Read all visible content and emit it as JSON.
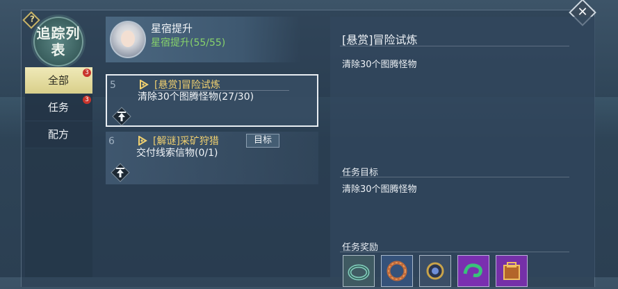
{
  "window": {
    "title": "追踪列表",
    "help_icon": "?",
    "close_icon": "✕"
  },
  "tabs": [
    {
      "label": "全部",
      "badge": "3",
      "active": true
    },
    {
      "label": "任务",
      "badge": "3",
      "active": false
    },
    {
      "label": "配方",
      "badge": "",
      "active": false
    }
  ],
  "star_card": {
    "title": "星宿提升",
    "subtitle": "星宿提升(55/55)"
  },
  "quests": [
    {
      "index": "5",
      "title": "[悬赏]冒险试炼",
      "desc": "清除30个图腾怪物(27/30)",
      "goal_label": "",
      "selected": true
    },
    {
      "index": "6",
      "title": "[解谜]采矿狩猎",
      "desc": "交付线索信物(0/1)",
      "goal_label": "目标",
      "selected": false
    }
  ],
  "detail": {
    "title": "[悬赏]冒险试炼",
    "description": "清除30个图腾怪物",
    "goal_heading": "任务目标",
    "goal_text": "清除30个图腾怪物",
    "reward_heading": "任务奖励",
    "rewards": [
      {
        "icon": "ring-icon",
        "bg": "#3f5a62"
      },
      {
        "icon": "bracelet-icon",
        "bg": "#35527a"
      },
      {
        "icon": "gem-icon",
        "bg": "#3b4e66"
      },
      {
        "icon": "jade-icon",
        "bg": "#7a2fb0"
      },
      {
        "icon": "chest-icon",
        "bg": "#7530a8"
      }
    ]
  },
  "colors": {
    "quest_title": "#f0d070",
    "progress_green": "#87d36b",
    "badge_red": "#c8342c"
  }
}
